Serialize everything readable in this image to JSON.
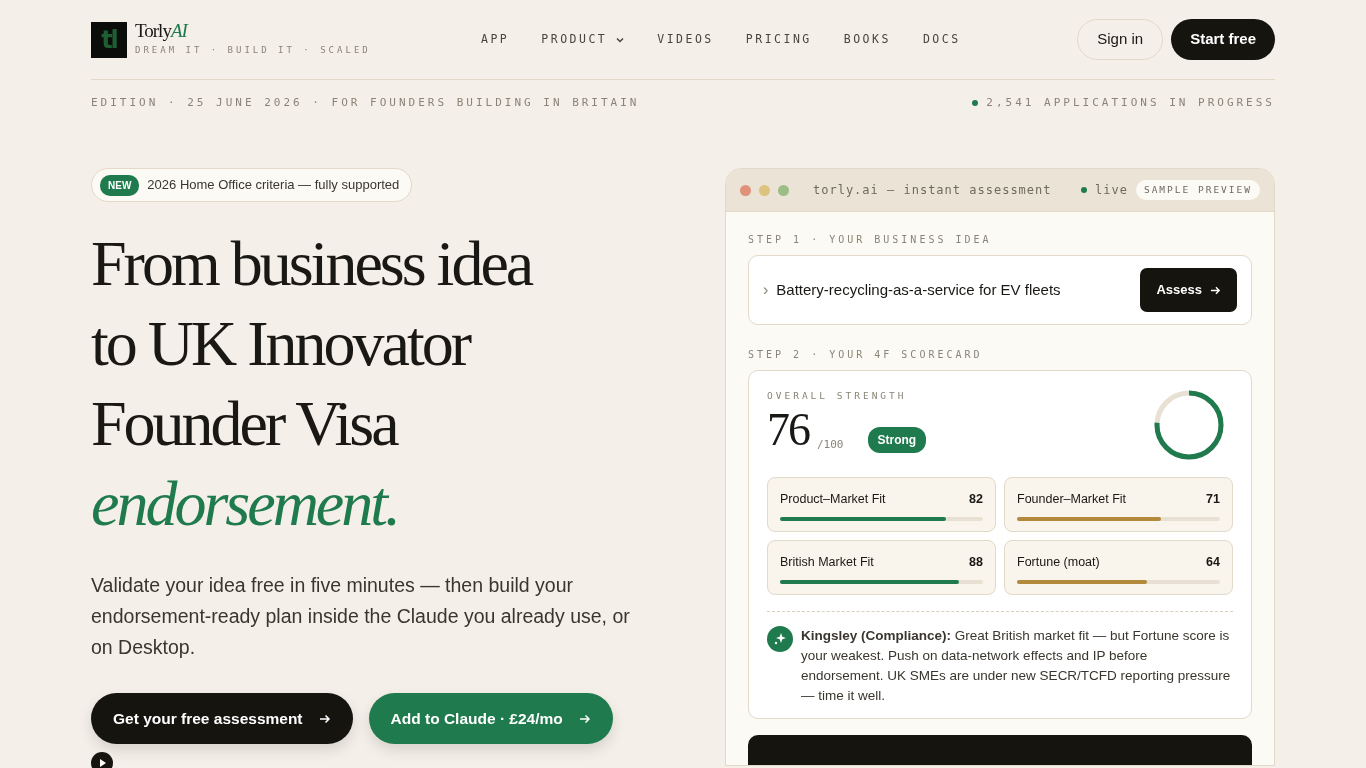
{
  "brand": {
    "name": "Torly",
    "accent": "AI",
    "logo_text": "tl",
    "tagline": "DREAM IT · BUILD IT · SCALED"
  },
  "nav": [
    {
      "label": "APP",
      "dropdown": false
    },
    {
      "label": "PRODUCT",
      "dropdown": true
    },
    {
      "label": "VIDEOS",
      "dropdown": false
    },
    {
      "label": "PRICING",
      "dropdown": false
    },
    {
      "label": "BOOKS",
      "dropdown": false
    },
    {
      "label": "DOCS",
      "dropdown": false
    }
  ],
  "actions": [
    {
      "label": "Sign in",
      "kind": "outline"
    },
    {
      "label": "Start free",
      "kind": "dark"
    }
  ],
  "edition": "EDITION · 25 JUNE 2026 · FOR FOUNDERS BUILDING IN BRITAIN",
  "counter": {
    "text": "2,541 APPLICATIONS IN PROGRESS",
    "color": "#1f7a4d"
  },
  "hero": {
    "badge": "NEW",
    "notice": "2026 Home Office criteria — fully supported",
    "headline": [
      "From business idea",
      "to UK Innovator",
      "Founder Visa"
    ],
    "headline_accent": "endorsement.",
    "lead": "Validate your idea free in five minutes — then build your endorsement-ready plan inside the Claude you already use, or on Desktop.",
    "buttons": [
      {
        "label": "Get your free assessment",
        "kind": "dark"
      },
      {
        "label": "Add to Claude · £24/mo",
        "kind": "green"
      }
    ]
  },
  "preview": {
    "title": "torly.ai — instant assessment",
    "status": "live",
    "tag": "SAMPLE PREVIEW",
    "step1": "STEP 1 · YOUR BUSINESS IDEA",
    "prompt": "›",
    "idea": "Battery-recycling-as-a-service for EV fleets",
    "assess": "Assess",
    "step2": "STEP 2 · YOUR 4F SCORECARD",
    "overall_label": "OVERALL STRENGTH",
    "score": "76",
    "out_of": "/100",
    "rating": "Strong",
    "level": 0.76,
    "scores": [
      {
        "name": "Product–Market Fit",
        "value": "82",
        "level": 0.82,
        "color": "#1f7a4d"
      },
      {
        "name": "Founder–Market Fit",
        "value": "71",
        "level": 0.71,
        "color": "#b38a3c"
      },
      {
        "name": "British Market Fit",
        "value": "88",
        "level": 0.88,
        "color": "#1f7a4d"
      },
      {
        "name": "Fortune (moat)",
        "value": "64",
        "level": 0.64,
        "color": "#b38a3c"
      }
    ],
    "advice": "**Kingsley (Compliance):** Great British market fit — but Fortune score is your weakest. Push on data-network effects and IP before endorsement. UK SMEs are under new SECR/TCFD reporting pressure — time it well."
  }
}
